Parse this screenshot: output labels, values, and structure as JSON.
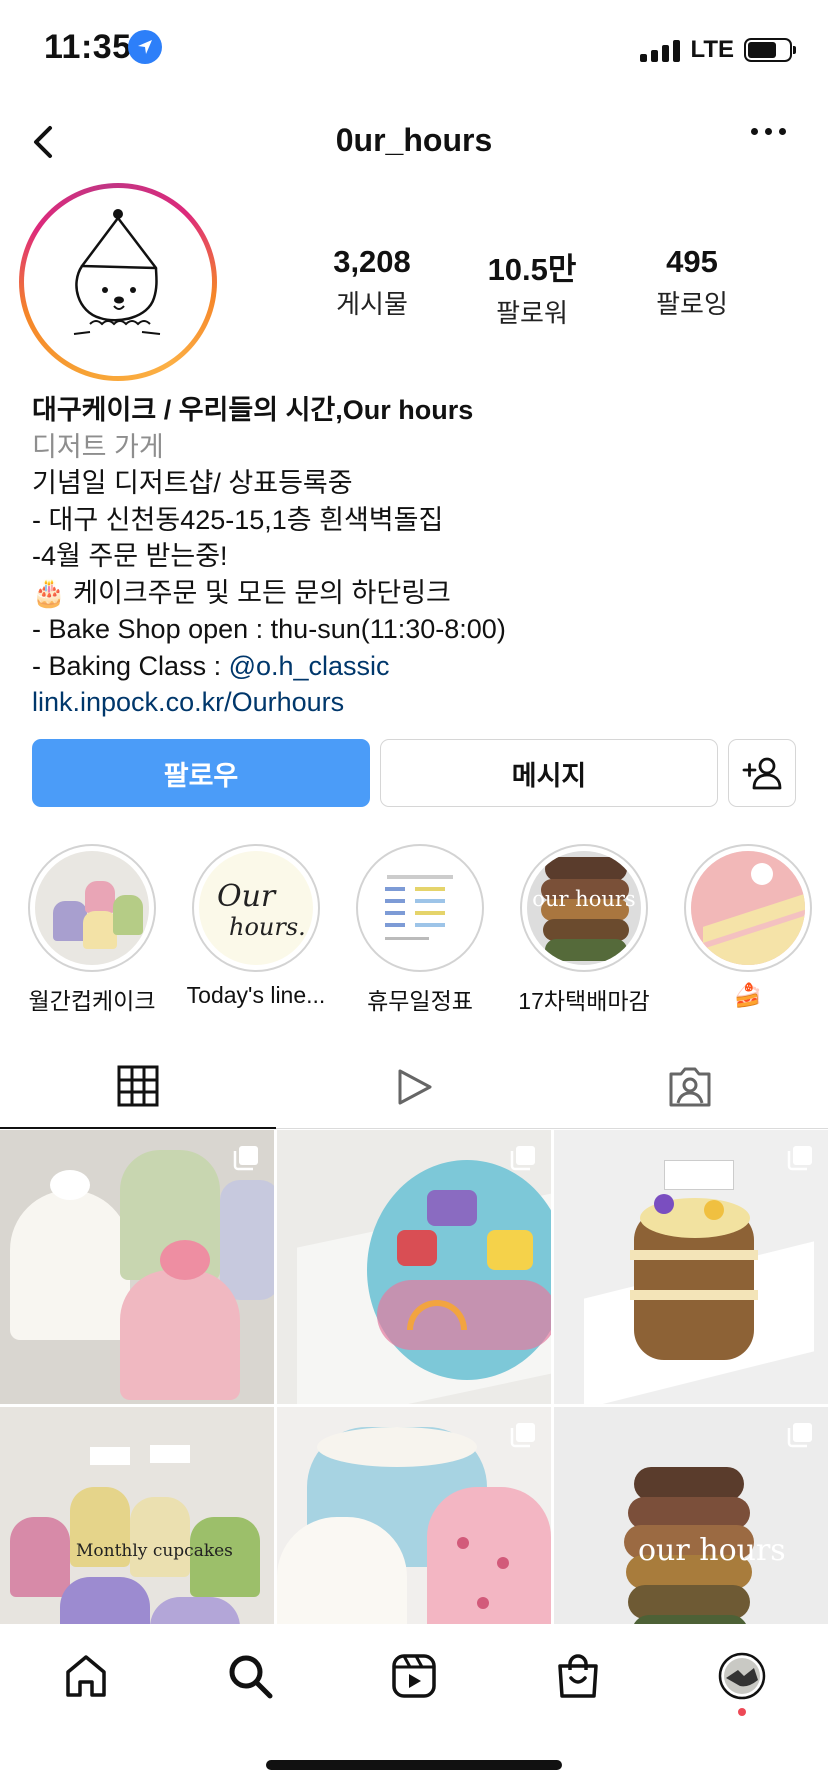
{
  "status_bar": {
    "time": "11:35",
    "network": "LTE",
    "battery_level": 0.7
  },
  "header": {
    "username": "0ur_hours"
  },
  "stats": [
    {
      "value": "3,208",
      "label": "게시물"
    },
    {
      "value": "10.5만",
      "label": "팔로워"
    },
    {
      "value": "495",
      "label": "팔로잉"
    }
  ],
  "bio": {
    "name": "대구케이크 / 우리들의 시간,Our hours",
    "category": "디저트 가게",
    "lines": [
      "기념일 디저트샵/ 상표등록중",
      "- 대구 신천동425-15,1층 흰색벽돌집",
      "-4월 주문 받는중!",
      "🎂 케이크주문 및 모든 문의 하단링크",
      "- Bake Shop open : thu-sun(11:30-8:00)"
    ],
    "class_prefix": "- Baking Class : ",
    "class_mention": "@o.h_classic",
    "link": "link.inpock.co.kr/Ourhours"
  },
  "buttons": {
    "follow": "팔로우",
    "message": "메시지"
  },
  "highlights": [
    {
      "label": "월간컵케이크"
    },
    {
      "label": "Today's line...",
      "logo_top": "Our",
      "logo_bottom": "hours."
    },
    {
      "label": "휴무일정표"
    },
    {
      "label": "17차택배마감",
      "overlay": "our hours"
    },
    {
      "label": "🍰"
    }
  ],
  "posts": [
    {
      "caption": ""
    },
    {
      "caption": ""
    },
    {
      "caption": ""
    },
    {
      "caption": "Monthly cupcakes"
    },
    {
      "caption": ""
    },
    {
      "caption": "our hours"
    }
  ],
  "icons": [
    "location-arrow-icon",
    "signal-icon",
    "battery-icon",
    "back-chevron-icon",
    "more-dots-icon",
    "add-person-icon",
    "grid-icon",
    "reels-play-icon",
    "tagged-person-icon",
    "home-icon",
    "search-icon",
    "reels-icon",
    "shop-bag-icon",
    "profile-avatar-icon"
  ],
  "colors": {
    "follow_button": "#4b9cf8",
    "link": "#00376b",
    "secondary_text": "#8e8e8e",
    "notification_dot": "#ed4956"
  }
}
